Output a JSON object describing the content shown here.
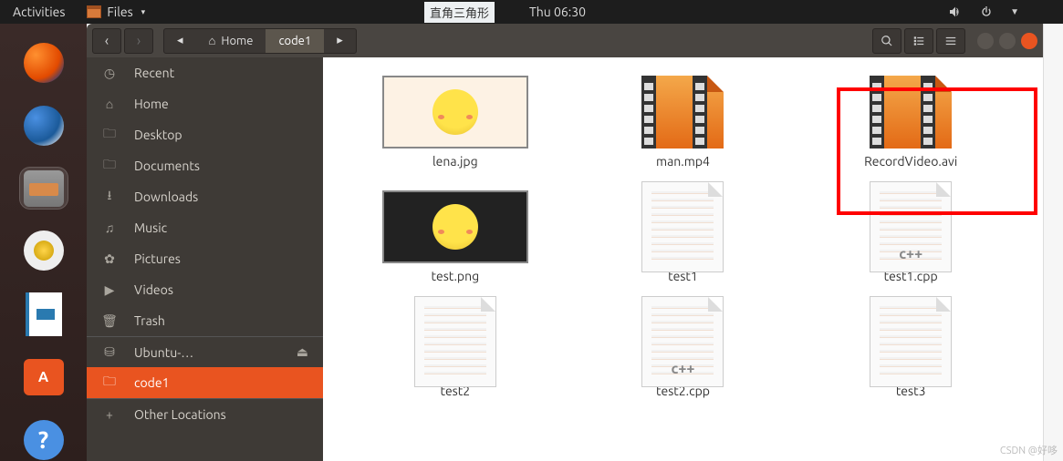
{
  "topbar": {
    "activities": "Activities",
    "files_label": "Files",
    "dropdown": "▾",
    "pill": "直角三角形",
    "clock": "Thu 06:30"
  },
  "dock": {
    "software_glyph": "A",
    "help_glyph": "?"
  },
  "toolbar": {
    "back": "‹",
    "forward": "›",
    "path_back": "◂",
    "path_forward": "▸",
    "home_icon": "⌂",
    "home_label": "Home",
    "current": "code1"
  },
  "sidebar": {
    "items": [
      {
        "icon": "◷",
        "label": "Recent"
      },
      {
        "icon": "⌂",
        "label": "Home"
      },
      {
        "icon": "🗀",
        "label": "Desktop"
      },
      {
        "icon": "🗀",
        "label": "Documents"
      },
      {
        "icon": "⭳",
        "label": "Downloads"
      },
      {
        "icon": "♫",
        "label": "Music"
      },
      {
        "icon": "✿",
        "label": "Pictures"
      },
      {
        "icon": "▶",
        "label": "Videos"
      },
      {
        "icon": "🗑",
        "label": "Trash"
      },
      {
        "icon": "⛁",
        "label": "Ubuntu-…",
        "eject": "⏏"
      },
      {
        "icon": "🗀",
        "label": "code1",
        "selected": true
      },
      {
        "icon": "+",
        "label": "Other Locations"
      }
    ]
  },
  "files": [
    {
      "name": "lena.jpg",
      "type": "image"
    },
    {
      "name": "man.mp4",
      "type": "video"
    },
    {
      "name": "RecordVideo.avi",
      "type": "video",
      "highlighted": true
    },
    {
      "name": "test.png",
      "type": "image-dark"
    },
    {
      "name": "test1",
      "type": "text"
    },
    {
      "name": "test1.cpp",
      "type": "cpp"
    },
    {
      "name": "test2",
      "type": "text"
    },
    {
      "name": "test2.cpp",
      "type": "cpp"
    },
    {
      "name": "test3",
      "type": "text"
    }
  ],
  "watermark": "CSDN @好哆"
}
